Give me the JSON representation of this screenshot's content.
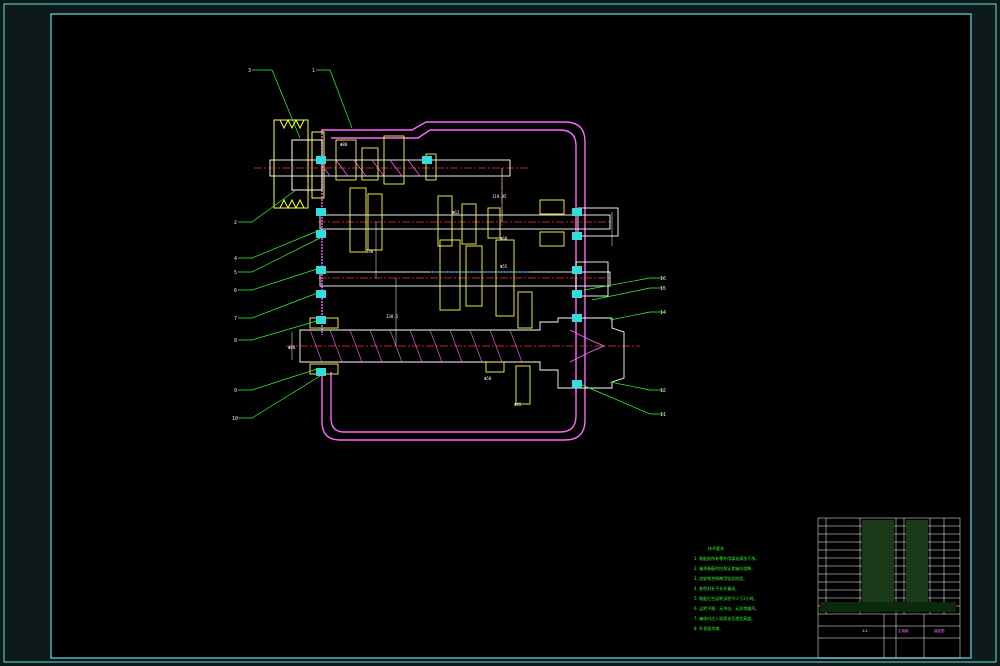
{
  "drawing": {
    "part_numbers": [
      "1",
      "2",
      "3",
      "4",
      "5",
      "6",
      "7",
      "8",
      "9",
      "10",
      "11",
      "12",
      "13",
      "14",
      "15",
      "16"
    ],
    "dimension_labels": [
      "Φ80",
      "Φ62",
      "Φ60",
      "Φ55",
      "Φ50",
      "Φ45",
      "140",
      "138.5",
      "119.95",
      "Φ68"
    ],
    "notes_title": "技术要求",
    "notes": [
      "1. 装配前所有零件用煤油清洗干净。",
      "2. 轴承装配时应保证其轴向游隙。",
      "3. 齿轮啮合侧隙用铅丝检验。",
      "4. 各密封处不允许漏油。",
      "5. 装配后空运转试验不少于2小时。",
      "6. 运转平稳，无冲击、无异常噪声。",
      "7. 箱体内注入润滑油至规定高度。",
      "8. 外表面涂漆。"
    ],
    "title_block": {
      "name": "主轴箱",
      "company": "装配图",
      "scale": "1:2"
    },
    "colors": {
      "bg": "#0d1818",
      "frame": "#5fe0e0",
      "outline": "#ffffff",
      "section": "#ff66ff",
      "part": "#ffff44",
      "leader": "#33ff33",
      "center": "#ff3333"
    }
  }
}
